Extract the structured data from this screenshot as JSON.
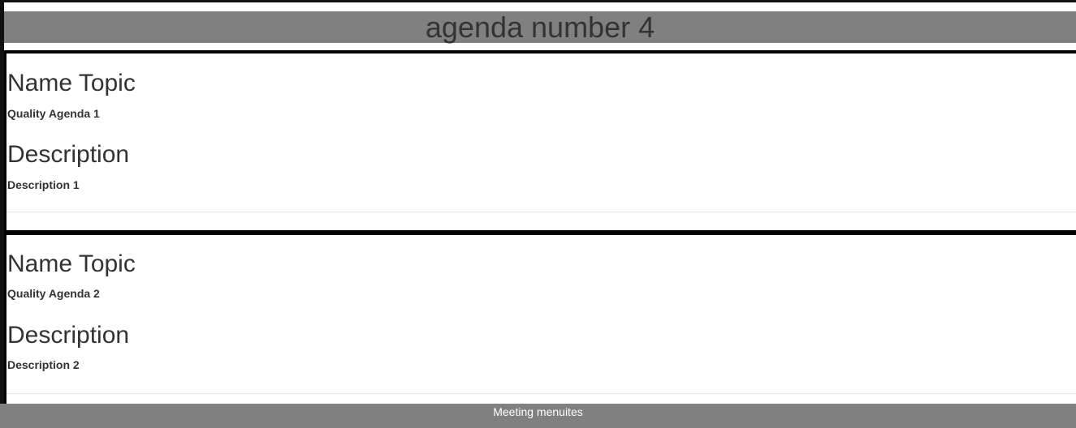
{
  "header": {
    "title": "agenda number 4"
  },
  "agenda_items": [
    {
      "name_heading": "Name Topic",
      "name_value": "Quality Agenda 1",
      "description_heading": "Description",
      "description_value": "Description 1"
    },
    {
      "name_heading": "Name Topic",
      "name_value": "Quality Agenda 2",
      "description_heading": "Description",
      "description_value": "Description 2"
    }
  ],
  "footer": {
    "text": "Meeting menuites"
  },
  "colors": {
    "header_bar": "#808080",
    "footer_bar": "#808080",
    "text": "#333333",
    "rule": "#000000"
  }
}
